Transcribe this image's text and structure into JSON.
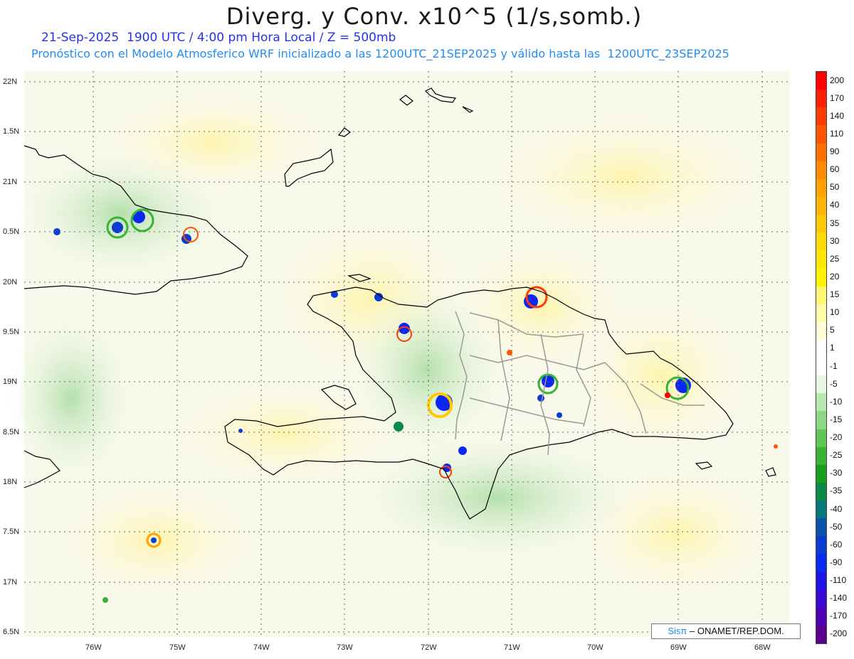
{
  "header": {
    "title": "Diverg. y Conv. x10^5 (1/s,somb.)",
    "date_line": "21-Sep-2025  1900 UTC / 4:00 pm Hora Local / Z = 500mb",
    "model_line": "Pronóstico con el Modelo Atmosferico WRF inicializado a las 1200UTC_21SEP2025 y válido hasta las  1200UTC_23SEP2025"
  },
  "axes": {
    "lat_labels": [
      "22N",
      "1.5N",
      "21N",
      "0.5N",
      "20N",
      "9.5N",
      "19N",
      "8.5N",
      "18N",
      "7.5N",
      "17N",
      "6.5N"
    ],
    "lon_labels": [
      "76W",
      "75W",
      "74W",
      "73W",
      "72W",
      "71W",
      "70W",
      "69W",
      "68W"
    ]
  },
  "legend": {
    "levels": [
      "200",
      "170",
      "140",
      "110",
      "90",
      "60",
      "50",
      "40",
      "35",
      "30",
      "25",
      "20",
      "15",
      "10",
      "5",
      "1",
      "-1",
      "-5",
      "-10",
      "-15",
      "-20",
      "-25",
      "-30",
      "-35",
      "-40",
      "-50",
      "-60",
      "-90",
      "-110",
      "-140",
      "-170",
      "-200"
    ],
    "colors": [
      "#ff0000",
      "#ff1e00",
      "#ff3c00",
      "#ff5500",
      "#ff7000",
      "#ff8c00",
      "#ffa200",
      "#ffb400",
      "#ffc800",
      "#ffdc00",
      "#ffe800",
      "#fff200",
      "#fff870",
      "#fffca8",
      "#fffed6",
      "#ffffff",
      "#ffffff",
      "#e8f6e4",
      "#b8e8b0",
      "#8cd884",
      "#60c658",
      "#38b432",
      "#18a01a",
      "#0e8a48",
      "#0a7878",
      "#0a55aa",
      "#0a3cd2",
      "#0a28f0",
      "#1e14e6",
      "#3c0ad2",
      "#5000b4",
      "#5a008c"
    ]
  },
  "credit": {
    "sis": "Sisπ",
    "org": "– ONAMET/REP.DOM."
  }
}
